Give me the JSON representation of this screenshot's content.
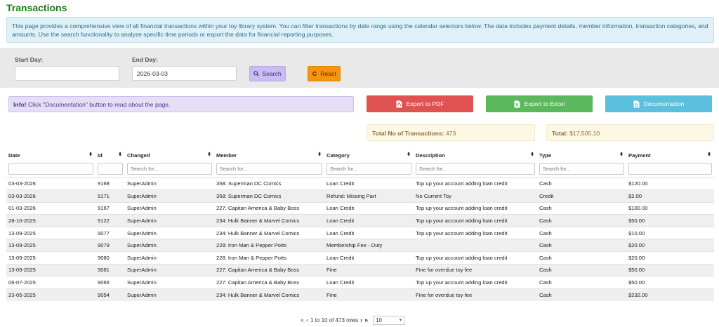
{
  "page": {
    "title": "Transactions",
    "intro": "This page provides a comprehensive view of all financial transactions within your toy library system. You can filter transactions by date range using the calendar selectors below. The data includes payment details, member information, transaction categories, and amounts. Use the search functionality to analyze specific time periods or export the data for financial reporting purposes."
  },
  "filters": {
    "start_label": "Start Day:",
    "start_value": "",
    "end_label": "End Day:",
    "end_value": "2026-03-03",
    "search_label": "Search",
    "reset_label": "Reset"
  },
  "info": {
    "strong": "Info!",
    "text": " Click \"Documentation\" button to read about the page."
  },
  "actions": {
    "pdf_label": "Export to PDF",
    "excel_label": "Export to Excel",
    "doc_label": "Documentation"
  },
  "stats": {
    "count_label": "Total No of Transactions:",
    "count_value": "473",
    "total_label": "Total:",
    "total_value": "$17,505.10"
  },
  "table": {
    "columns": [
      "Date",
      "Id",
      "Changed",
      "Member",
      "Category",
      "Description",
      "Type",
      "Payment"
    ],
    "filter_placeholders": [
      "",
      "",
      "Search for...",
      "Search for...",
      "Search for...",
      "Search for...",
      "Search for...",
      ""
    ],
    "rows": [
      [
        "03-03-2026",
        "9168",
        "SuperAdmin",
        "358: Superman DC Comics",
        "Loan Credit",
        "Top up your account adding loan credit",
        "Cash",
        "$120.00"
      ],
      [
        "03-03-2026",
        "9171",
        "SuperAdmin",
        "358: Superman DC Comics",
        "Refund: Missing Part",
        "No Current Toy",
        "Credit",
        "$2.00"
      ],
      [
        "01-03-2026",
        "9167",
        "SuperAdmin",
        "227: Capitan America & Baby Boss",
        "Loan Credit",
        "Top up your account adding loan credit",
        "Cash",
        "$100.00"
      ],
      [
        "28-10-2025",
        "9122",
        "SuperAdmin",
        "234: Hulk Banner & Marvel Comics",
        "Loan Credit",
        "Top up your account adding loan credit",
        "Cash",
        "$50.00"
      ],
      [
        "13-09-2025",
        "9077",
        "SuperAdmin",
        "234: Hulk Banner & Marvel Comics",
        "Loan Credit",
        "Top up your account adding loan credit",
        "Cash",
        "$10.00"
      ],
      [
        "13-09-2025",
        "9079",
        "SuperAdmin",
        "228: Iron Man & Pepper Potts",
        "Membership Fee - Duty",
        "",
        "Cash",
        "$20.00"
      ],
      [
        "13-09-2025",
        "9080",
        "SuperAdmin",
        "228: Iron Man & Pepper Potts",
        "Loan Credit",
        "Top up your account adding loan credit",
        "Cash",
        "$20.00"
      ],
      [
        "13-09-2025",
        "9081",
        "SuperAdmin",
        "227: Capitan America & Baby Boss",
        "Fine",
        "Fine for overdue toy fee",
        "Cash",
        "$50.00"
      ],
      [
        "06-07-2025",
        "9066",
        "SuperAdmin",
        "227: Capitan America & Baby Boss",
        "Loan Credit",
        "Top up your account adding loan credit",
        "Cash",
        "$50.00"
      ],
      [
        "23-05-2025",
        "9054",
        "SuperAdmin",
        "234: Hulk Banner & Marvel Comics",
        "Fine",
        "Fine for overdue toy fee",
        "Cash",
        "$232.00"
      ]
    ]
  },
  "pager": {
    "summary": "1 to 10 of 473 rows",
    "page_size": "10"
  },
  "icons": {
    "search": "search-icon",
    "reset": "refresh-icon",
    "pdf": "pdf-file-icon",
    "excel": "excel-file-icon",
    "doc": "document-icon"
  },
  "colors": {
    "title": "#1a7d1a",
    "pdf": "#e05252",
    "excel": "#5cb85c",
    "doc": "#5bc0de",
    "reset": "#f5940f",
    "search": "#c8bdf0"
  }
}
